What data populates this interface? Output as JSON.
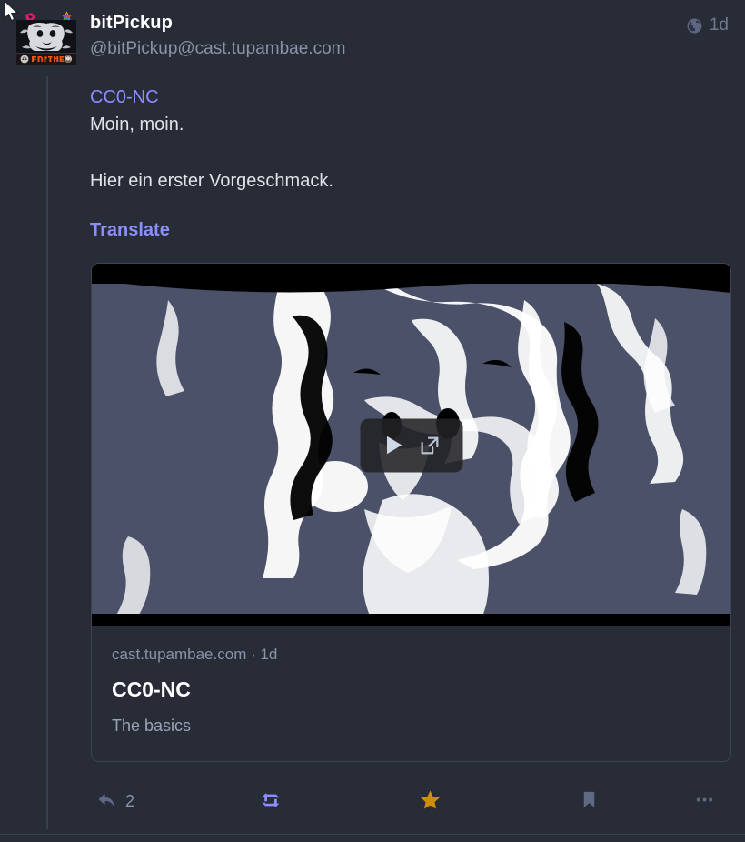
{
  "post": {
    "display_name": "bitPickup",
    "handle": "@bitPickup@cast.tupambae.com",
    "visibility_icon": "globe-icon",
    "time_ago": "1d",
    "content_link": "CC0-NC",
    "line_1": "Moin, moin.",
    "line_2": "Hier ein erster Vorgeschmack.",
    "translate_label": "Translate"
  },
  "media": {
    "play_icon": "play-icon",
    "expand_icon": "external-link-icon"
  },
  "link_card": {
    "provider": "cast.tupambae.com · 1d",
    "title": "CC0-NC",
    "description": "The basics"
  },
  "actions": [
    {
      "name": "reply-button",
      "icon": "reply-icon",
      "count": "2",
      "active": false
    },
    {
      "name": "boost-button",
      "icon": "boost-icon",
      "count": "",
      "active": true
    },
    {
      "name": "favourite-button",
      "icon": "star-icon",
      "count": "",
      "active": true
    },
    {
      "name": "bookmark-button",
      "icon": "bookmark-icon",
      "count": "",
      "active": false
    },
    {
      "name": "more-button",
      "icon": "ellipsis-icon",
      "count": "",
      "active": false
    }
  ],
  "colors": {
    "background": "#282c37",
    "link": "#8c8dff",
    "boost_active": "#8c8dff",
    "favourite_active": "#ca8f04",
    "muted": "#606984",
    "text": "#dfe2e8",
    "border": "#393f4f"
  }
}
